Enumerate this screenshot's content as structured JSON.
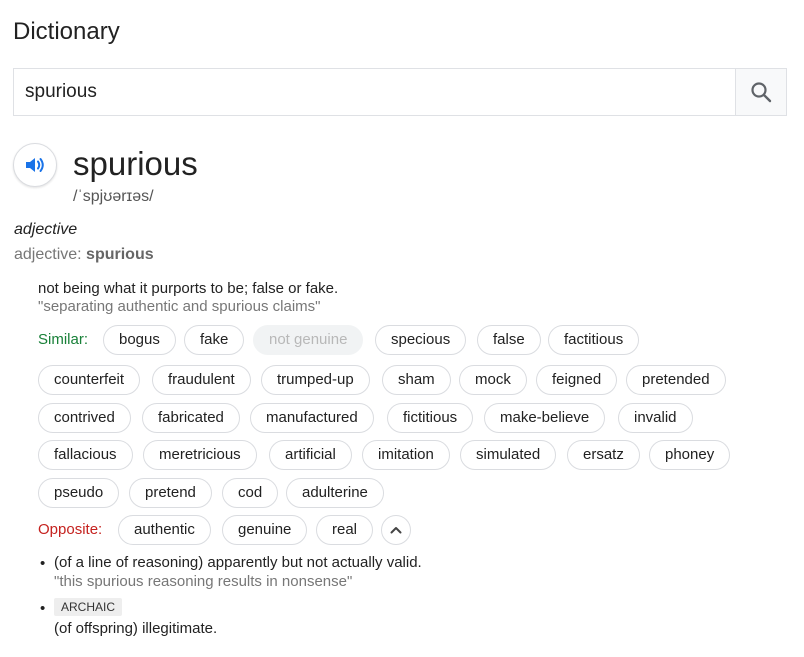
{
  "title": "Dictionary",
  "search": {
    "value": "spurious",
    "icon": "search-icon"
  },
  "entry": {
    "word": "spurious",
    "phonetic": "/ˈspjʊərɪəs/",
    "pos": "adjective",
    "pos_prefix": "adjective: ",
    "pos_word": "spurious",
    "sense1": {
      "definition": "not being what it purports to be; false or fake.",
      "example": "\"separating authentic and spurious claims\"",
      "similar_label": "Similar:",
      "similar": [
        "bogus",
        "fake",
        "not genuine",
        "specious",
        "false",
        "factitious",
        "counterfeit",
        "fraudulent",
        "trumped-up",
        "sham",
        "mock",
        "feigned",
        "pretended",
        "contrived",
        "fabricated",
        "manufactured",
        "fictitious",
        "make-believe",
        "invalid",
        "fallacious",
        "meretricious",
        "artificial",
        "imitation",
        "simulated",
        "ersatz",
        "phoney",
        "pseudo",
        "pretend",
        "cod",
        "adulterine"
      ],
      "opposite_label": "Opposite:",
      "opposite": [
        "authentic",
        "genuine",
        "real"
      ]
    },
    "sense2": {
      "definition": "(of a line of reasoning) apparently but not actually valid.",
      "example": "\"this spurious reasoning results in nonsense\""
    },
    "sense3": {
      "register": "ARCHAIC",
      "definition": "(of offspring) illegitimate."
    }
  },
  "colors": {
    "similar": "#188038",
    "opposite": "#c5221f",
    "accent": "#1a73e8"
  }
}
